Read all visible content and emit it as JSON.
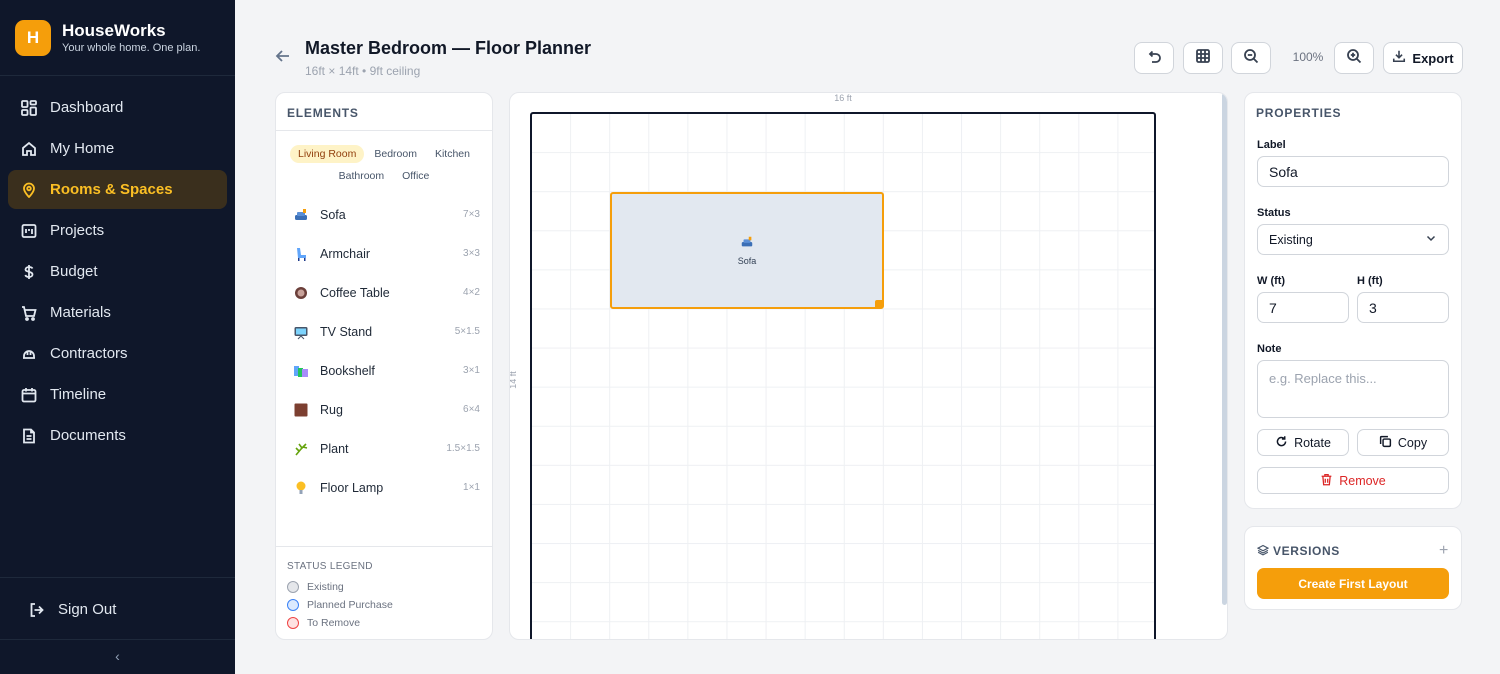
{
  "brand": {
    "initial": "H",
    "name": "HouseWorks",
    "tagline": "Your whole home. One plan.",
    "accent": "#f59e0b"
  },
  "nav": {
    "items": [
      {
        "label": "Dashboard",
        "icon": "dashboard-icon"
      },
      {
        "label": "My Home",
        "icon": "home-icon"
      },
      {
        "label": "Rooms & Spaces",
        "icon": "location-pin-icon",
        "active": true
      },
      {
        "label": "Projects",
        "icon": "projects-icon"
      },
      {
        "label": "Budget",
        "icon": "dollar-icon"
      },
      {
        "label": "Materials",
        "icon": "cart-icon"
      },
      {
        "label": "Contractors",
        "icon": "hard-hat-icon"
      },
      {
        "label": "Timeline",
        "icon": "calendar-icon"
      },
      {
        "label": "Documents",
        "icon": "document-icon"
      }
    ],
    "sign_out": "Sign Out"
  },
  "header": {
    "title": "Master Bedroom — Floor Planner",
    "subtitle": "16ft × 14ft • 9ft ceiling",
    "zoom": "100%",
    "export": "Export"
  },
  "elements_panel": {
    "title": "ELEMENTS",
    "categories": [
      "Living Room",
      "Bedroom",
      "Kitchen",
      "Bathroom",
      "Office"
    ],
    "active_category": "Living Room",
    "items": [
      {
        "name": "Sofa",
        "dim": "7×3",
        "icon": "sofa-icon"
      },
      {
        "name": "Armchair",
        "dim": "3×3",
        "icon": "armchair-icon"
      },
      {
        "name": "Coffee Table",
        "dim": "4×2",
        "icon": "coffee-table-icon"
      },
      {
        "name": "TV Stand",
        "dim": "5×1.5",
        "icon": "tv-icon"
      },
      {
        "name": "Bookshelf",
        "dim": "3×1",
        "icon": "books-icon"
      },
      {
        "name": "Rug",
        "dim": "6×4",
        "icon": "rug-icon"
      },
      {
        "name": "Plant",
        "dim": "1.5×1.5",
        "icon": "plant-icon"
      },
      {
        "name": "Floor Lamp",
        "dim": "1×1",
        "icon": "lamp-icon"
      }
    ],
    "legend": {
      "title": "STATUS LEGEND",
      "items": [
        {
          "label": "Existing",
          "color": "#9ca3af"
        },
        {
          "label": "Planned Purchase",
          "color": "#3b82f6"
        },
        {
          "label": "To Remove",
          "color": "#ef4444"
        }
      ]
    }
  },
  "canvas": {
    "width_label": "16 ft",
    "height_label": "14 ft",
    "placed_item_label": "Sofa"
  },
  "properties": {
    "title": "PROPERTIES",
    "label_label": "Label",
    "label_value": "Sofa",
    "status_label": "Status",
    "status_value": "Existing",
    "w_label": "W (ft)",
    "w_value": "7",
    "h_label": "H (ft)",
    "h_value": "3",
    "note_label": "Note",
    "note_placeholder": "e.g. Replace this...",
    "rotate": "Rotate",
    "copy": "Copy",
    "remove": "Remove"
  },
  "versions": {
    "title": "VERSIONS",
    "create": "Create First Layout"
  }
}
